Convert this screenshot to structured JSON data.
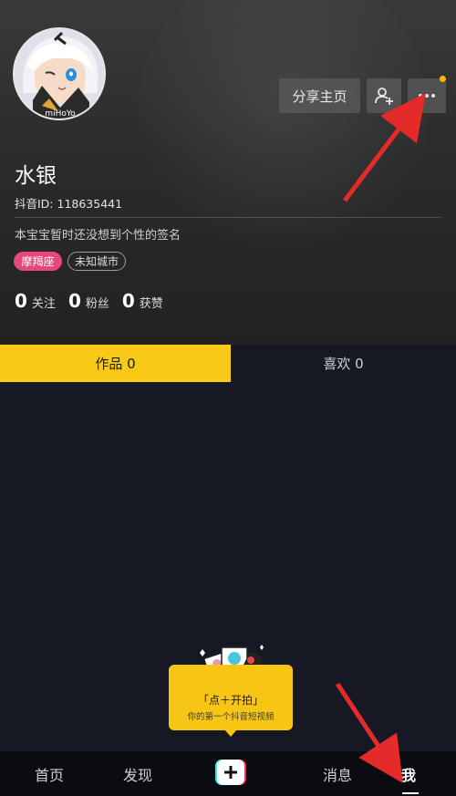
{
  "profile": {
    "name": "水银",
    "douyin_id": "抖音ID: 118635441",
    "signature": "本宝宝暂时还没想到个性的签名",
    "zodiac": "摩羯座",
    "city": "未知城市",
    "avatar_watermark": "miHoYo"
  },
  "header": {
    "share_label": "分享主页",
    "add_friend_icon": "add-friend-icon",
    "more_icon": "more-icon"
  },
  "stats": {
    "following_count": "0",
    "following_label": "关注",
    "fans_count": "0",
    "fans_label": "粉丝",
    "likes_count": "0",
    "likes_label": "获赞"
  },
  "tabs": {
    "works": "作品 0",
    "likes": "喜欢 0"
  },
  "promo": {
    "title": "「点＋开拍」",
    "subtitle": "你的第一个抖音短视频"
  },
  "nav": {
    "home": "首页",
    "discover": "发现",
    "messages": "消息",
    "me": "我"
  },
  "colors": {
    "accent_yellow": "#f8c917",
    "zodiac_pink": "#e8467e",
    "background": "#161823",
    "annotation_red": "#e52a2a"
  }
}
